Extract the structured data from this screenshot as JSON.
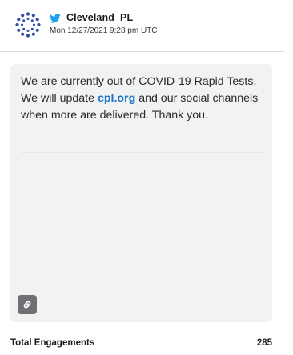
{
  "header": {
    "handle": "Cleveland_PL",
    "timestamp": "Mon 12/27/2021 9:28 pm UTC",
    "network_icon": "twitter-bird-icon",
    "avatar_icon": "dotted-ring-logo-icon"
  },
  "post": {
    "text_before_link": "We are currently out of COVID-19 Rapid Tests. We will update ",
    "link_text": "cpl.org",
    "text_after_link": " and our social channels when more are delivered. Thank you.",
    "link_button_icon": "link-chain-icon"
  },
  "metrics": {
    "total_engagements_label": "Total Engagements",
    "total_engagements_value": "285"
  },
  "colors": {
    "twitter_blue": "#1da1f2",
    "link_blue": "#1a73c8",
    "card_bg": "#f1f2f2",
    "avatar_blue": "#2f4ea3"
  }
}
